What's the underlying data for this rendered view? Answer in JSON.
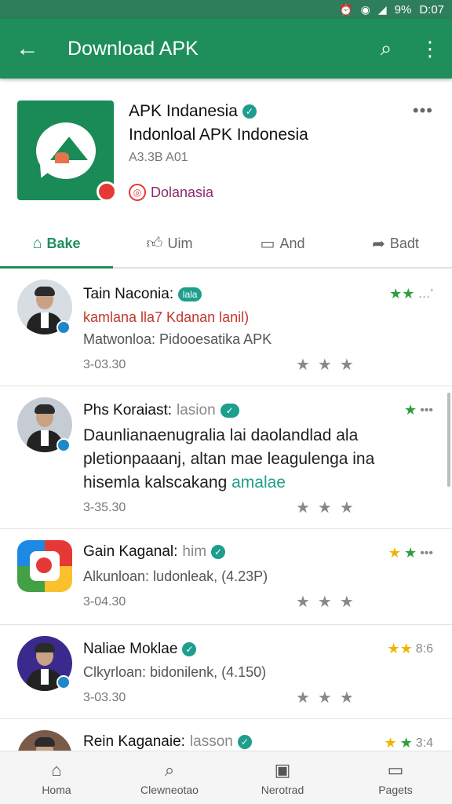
{
  "status_bar": {
    "battery": "9%",
    "time": "D:07",
    "icons": [
      "alarm-icon",
      "wifi-icon",
      "signal-icon"
    ]
  },
  "app_bar": {
    "title": "Download APK"
  },
  "app": {
    "name": "APK Indanesia",
    "subtitle": "Indonloal APK Indonesia",
    "meta": "A3.3B A01",
    "developer": "Dolanasia"
  },
  "tabs": [
    {
      "label": "Bake",
      "icon": "home-icon"
    },
    {
      "label": "Uim",
      "icon": "like-icon"
    },
    {
      "label": "And",
      "icon": "comment-icon"
    },
    {
      "label": "Badt",
      "icon": "share-icon"
    }
  ],
  "items": [
    {
      "title": "Tain Naconia:",
      "badge": "lala",
      "line1": "kamlana lla7 Kdanan lanil)",
      "line2": "Matwonloa: Pidooesatika APK",
      "date": "3-03.30",
      "top_right": "…’"
    },
    {
      "title": "Phs Koraiast:",
      "muted": "lasion",
      "body_main": "Daunlianaenugralia lai daolandlad ala pletionpaaanj, altan mae leagulenga ina hisemla kalscakang",
      "body_teal": "amalae",
      "date": "3-35.30",
      "top_right": "•••"
    },
    {
      "title": "Gain Kaganal:",
      "muted": "him",
      "line1": "Alkunloan: ludonleak, (4.23P)",
      "date": "3-04.30",
      "top_right": "•••"
    },
    {
      "title": "Naliae Moklae",
      "line1": "Clkyrloan: bidonilenk, (4.150)",
      "date": "3-03.30",
      "top_right": "8:6"
    },
    {
      "title": "Rein Kaganaie:",
      "muted": "lasson",
      "top_right": "3:4"
    }
  ],
  "bottom_nav": [
    {
      "label": "Homa",
      "icon": "home-icon"
    },
    {
      "label": "Clewneotao",
      "icon": "search-icon"
    },
    {
      "label": "Nerotrad",
      "icon": "downloads-icon"
    },
    {
      "label": "Pagets",
      "icon": "pages-icon"
    }
  ],
  "colors": {
    "primary": "#1e8f5a",
    "status_bar": "#2e7d5b",
    "verified": "#1e9e8c",
    "star_green": "#2e9e3f",
    "star_gold": "#f0b400"
  }
}
